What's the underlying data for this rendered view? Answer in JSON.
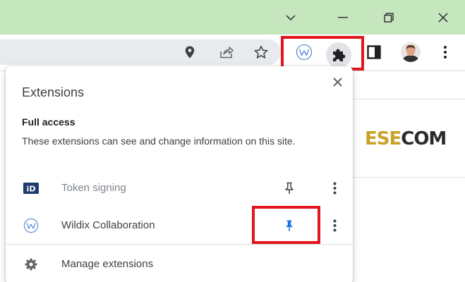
{
  "window_controls": {
    "tab_search_icon": "chevron-down-icon",
    "minimize_icon": "minimize-icon",
    "restore_icon": "restore-icon",
    "close_icon": "close-icon"
  },
  "toolbar": {
    "icons": [
      "location-pin-icon",
      "share-icon",
      "bookmark-star-icon",
      "wildix-extension-icon",
      "extensions-puzzle-icon",
      "side-panel-icon",
      "profile-avatar",
      "kebab-menu-icon"
    ]
  },
  "page": {
    "brand": {
      "part1": "ESE",
      "part2": "COM"
    }
  },
  "popup": {
    "title": "Extensions",
    "section_title": "Full access",
    "section_desc": "These extensions can see and change information on this site.",
    "extensions": [
      {
        "badge": "iD",
        "name": "Token signing",
        "pinned": false
      },
      {
        "badge": "W",
        "name": "Wildix Collaboration",
        "pinned": true
      }
    ],
    "manage_label": "Manage extensions"
  },
  "colors": {
    "titlebar": "#c6e6bd",
    "highlight": "#e3151d",
    "pin_active": "#1a73e8",
    "brand_accent": "#c9a227",
    "wildix_blue": "#5b8fd6"
  }
}
